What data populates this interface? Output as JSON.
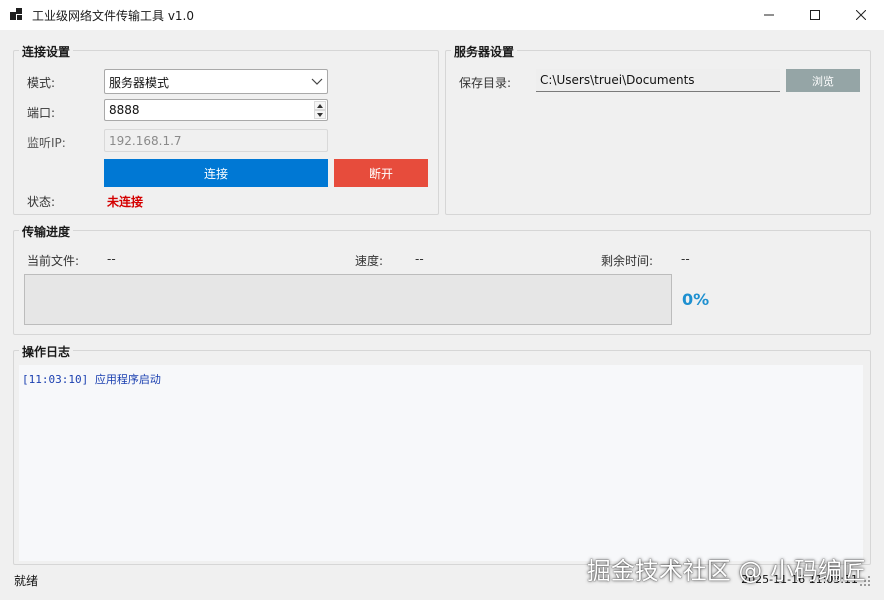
{
  "window": {
    "title": "工业级网络文件传输工具 v1.0"
  },
  "connection": {
    "group_title": "连接设置",
    "mode_label": "模式:",
    "mode_value": "服务器模式",
    "port_label": "端口:",
    "port_value": "8888",
    "listen_ip_label": "监听IP:",
    "listen_ip_value": "192.168.1.7",
    "connect_label": "连接",
    "disconnect_label": "断开",
    "status_label": "状态:",
    "status_value": "未连接"
  },
  "server": {
    "group_title": "服务器设置",
    "save_dir_label": "保存目录:",
    "save_dir_value": "C:\\Users\\truei\\Documents",
    "browse_label": "浏览"
  },
  "progress": {
    "group_title": "传输进度",
    "current_file_label": "当前文件:",
    "current_file_value": "--",
    "speed_label": "速度:",
    "speed_value": "--",
    "remaining_label": "剩余时间:",
    "remaining_value": "--",
    "percent_text": "0%",
    "fraction": 0
  },
  "log": {
    "group_title": "操作日志",
    "entries": [
      "[11:03:10] 应用程序启动"
    ]
  },
  "statusbar": {
    "ready_text": "就绪",
    "datetime": "2025-11-16 11:03:11"
  },
  "watermark": "掘金技术社区 @ 小码编匠",
  "colors": {
    "connect_button": "#0078d4",
    "disconnect_button": "#e74c3c",
    "browse_button": "#95a5a6",
    "status_disconnected": "#d40000",
    "percent_text": "#1e90d0",
    "log_text": "#1a3fb0"
  },
  "icons": {
    "app": "app-icon",
    "minimize": "minimize-icon",
    "maximize": "maximize-icon",
    "close": "close-icon",
    "combo_arrow": "chevron-down-icon",
    "spin_up": "spin-up-icon",
    "spin_down": "spin-down-icon",
    "size_grip": "size-grip-icon"
  }
}
